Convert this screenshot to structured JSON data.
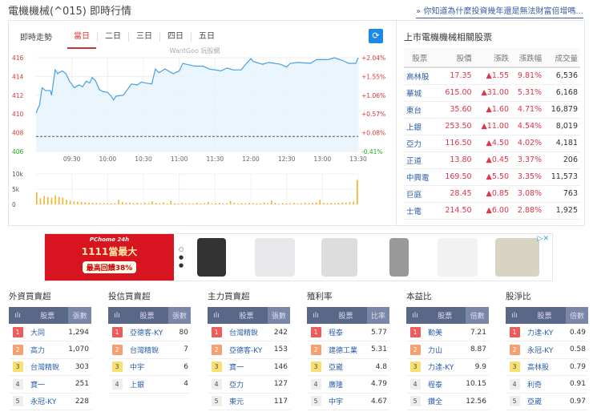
{
  "header": {
    "title": "電機機械(^015) 即時行情",
    "tip_link": "» 你知道為什麼投資幾年還是無法財富倍增嗎..."
  },
  "chart_panel": {
    "label": "即時走勢",
    "tabs": [
      "當日",
      "二日",
      "三日",
      "四日",
      "五日"
    ],
    "active_tab": "當日",
    "watermark": "WantGoo 玩股網",
    "refresh_icon": "refresh-icon"
  },
  "chart_data": {
    "type": "line",
    "title": "即時走勢",
    "reference_price": 407.6,
    "ylim": [
      406,
      416
    ],
    "yticks": [
      "416",
      "414",
      "412",
      "410",
      "408",
      "406"
    ],
    "pct_ticks": [
      "+2.04%",
      "+1.55%",
      "+1.06%",
      "+0.57%",
      "+0.08%",
      "-0.41%"
    ],
    "xticks": [
      "09:30",
      "10:00",
      "10:30",
      "11:00",
      "11:30",
      "12:00",
      "12:30",
      "13:00",
      "13:30"
    ],
    "x_minutes": [
      0,
      3,
      5,
      8,
      12,
      13,
      16,
      18,
      22,
      25,
      28,
      32,
      36,
      39,
      42,
      45,
      47,
      50,
      53,
      56,
      60,
      63,
      65,
      67,
      73,
      76,
      80,
      85,
      88,
      92,
      97,
      100,
      103,
      108,
      115,
      120,
      123,
      126,
      133,
      140,
      145,
      155,
      160,
      165,
      172,
      175,
      180,
      182,
      190,
      195,
      205,
      210,
      213,
      220,
      230,
      235,
      245,
      250,
      257,
      262,
      268,
      270
    ],
    "price": [
      410.1,
      411,
      412.8,
      412.5,
      412.5,
      412,
      414.7,
      414.3,
      414.6,
      414.3,
      413.5,
      412.8,
      413.1,
      412.9,
      413.5,
      413.3,
      413.9,
      413.5,
      412.6,
      412.4,
      412.3,
      411.9,
      411.5,
      411.9,
      412,
      412.5,
      413.2,
      413.1,
      413.4,
      413.3,
      413.2,
      414.8,
      414.4,
      414.8,
      414.3,
      414.6,
      415.4,
      415.3,
      415.1,
      415.1,
      414.8,
      414.6,
      414.9,
      414.7,
      414.7,
      415.2,
      415.9,
      415.6,
      415.3,
      415.5,
      415.3,
      415,
      415.4,
      415.5,
      415.4,
      415.8,
      415.8,
      416,
      415.7,
      415.4,
      415.4,
      416
    ],
    "volume_yticks": [
      "10k",
      "5k",
      "0"
    ],
    "volume_ylim": [
      0,
      10
    ],
    "volume_k": [
      4,
      2,
      2.8,
      2.5,
      2.2,
      3,
      2.5,
      2.2,
      1.5,
      1.2,
      1,
      0.9,
      0.8,
      0.7,
      0.6,
      0.5,
      0.5,
      0.4,
      0.4,
      0.4,
      0.3,
      0.4,
      1.5,
      0.8,
      0.5,
      0.6,
      0.4,
      0.5,
      0.3,
      0.6,
      0.4,
      1,
      0.5,
      0.4,
      0.7,
      0.3,
      1.2,
      0.4,
      0.3,
      0.5,
      0.3,
      0.4,
      0.3,
      0.5,
      0.3,
      0.4,
      0.8,
      0.3,
      0.4,
      0.5,
      0.3,
      0.4,
      1.1,
      0.5,
      0.3,
      0.4,
      0.3,
      0.5,
      0.4,
      0.3,
      0.3,
      0.6,
      0.4,
      1.2,
      0.5,
      0.3,
      0.4,
      0.3,
      0.4,
      0.5,
      0.3,
      0.4,
      0.6,
      0.4,
      0.5,
      0.7,
      1.5,
      0.5,
      0.4,
      0.5,
      0.4,
      0.5,
      0.7,
      0.6,
      0.8,
      0.9,
      8
    ]
  },
  "related": {
    "title": "上市電機機械相關股票",
    "columns": [
      "股票",
      "股價",
      "漲跌",
      "漲跌幅",
      "成交量"
    ],
    "rows": [
      [
        "高林股",
        "17.35",
        "▲1.55",
        "9.81%",
        "6,536"
      ],
      [
        "華城",
        "615.00",
        "▲31.00",
        "5.31%",
        "6,168"
      ],
      [
        "東台",
        "35.60",
        "▲1.60",
        "4.71%",
        "16,879"
      ],
      [
        "上銀",
        "253.50",
        "▲11.00",
        "4.54%",
        "8,019"
      ],
      [
        "亞力",
        "116.50",
        "▲4.50",
        "4.02%",
        "4,181"
      ],
      [
        "正道",
        "13.80",
        "▲0.45",
        "3.37%",
        "206"
      ],
      [
        "中興電",
        "169.50",
        "▲5.50",
        "3.35%",
        "11,573"
      ],
      [
        "巨庭",
        "28.45",
        "▲0.85",
        "3.08%",
        "763"
      ],
      [
        "士電",
        "214.50",
        "▲6.00",
        "2.88%",
        "1,925"
      ]
    ]
  },
  "ad": {
    "brand": "PChome 24h",
    "headline": "1111當最大",
    "offer": "最高回饋38%"
  },
  "rankings": [
    {
      "title": "外資買賣超",
      "col_stock": "股票",
      "col_value": "張數",
      "rows": [
        [
          "1",
          "大同",
          "1,294"
        ],
        [
          "2",
          "高力",
          "1,070"
        ],
        [
          "3",
          "台灣精銳",
          "303"
        ],
        [
          "4",
          "寶一",
          "251"
        ],
        [
          "5",
          "永冠-KY",
          "228"
        ]
      ]
    },
    {
      "title": "投信買賣超",
      "col_stock": "股票",
      "col_value": "張數",
      "rows": [
        [
          "1",
          "亞德客-KY",
          "80"
        ],
        [
          "2",
          "台灣精銳",
          "7"
        ],
        [
          "3",
          "中宇",
          "6"
        ],
        [
          "4",
          "上銀",
          "4"
        ]
      ]
    },
    {
      "title": "主力買賣超",
      "col_stock": "股票",
      "col_value": "張數",
      "rows": [
        [
          "1",
          "台灣精銳",
          "242"
        ],
        [
          "2",
          "亞德客-KY",
          "153"
        ],
        [
          "3",
          "寶一",
          "146"
        ],
        [
          "4",
          "亞力",
          "127"
        ],
        [
          "5",
          "東元",
          "117"
        ]
      ]
    },
    {
      "title": "殖利率",
      "col_stock": "股票",
      "col_value": "比率",
      "rows": [
        [
          "1",
          "程泰",
          "5.77"
        ],
        [
          "2",
          "建德工業",
          "5.31"
        ],
        [
          "3",
          "亞崴",
          "4.8"
        ],
        [
          "4",
          "廣隆",
          "4.79"
        ],
        [
          "5",
          "中宇",
          "4.67"
        ]
      ]
    },
    {
      "title": "本益比",
      "col_stock": "股票",
      "col_value": "倍數",
      "rows": [
        [
          "1",
          "勤美",
          "7.21"
        ],
        [
          "2",
          "力山",
          "8.87"
        ],
        [
          "3",
          "力達-KY",
          "9.9"
        ],
        [
          "4",
          "程泰",
          "10.15"
        ],
        [
          "5",
          "鑽全",
          "12.56"
        ]
      ]
    },
    {
      "title": "股淨比",
      "col_stock": "股票",
      "col_value": "倍數",
      "rows": [
        [
          "1",
          "力達-KY",
          "0.49"
        ],
        [
          "2",
          "永冠-KY",
          "0.58"
        ],
        [
          "3",
          "高林股",
          "0.79"
        ],
        [
          "4",
          "利奇",
          "0.91"
        ],
        [
          "5",
          "亞崴",
          "0.97"
        ]
      ]
    }
  ]
}
